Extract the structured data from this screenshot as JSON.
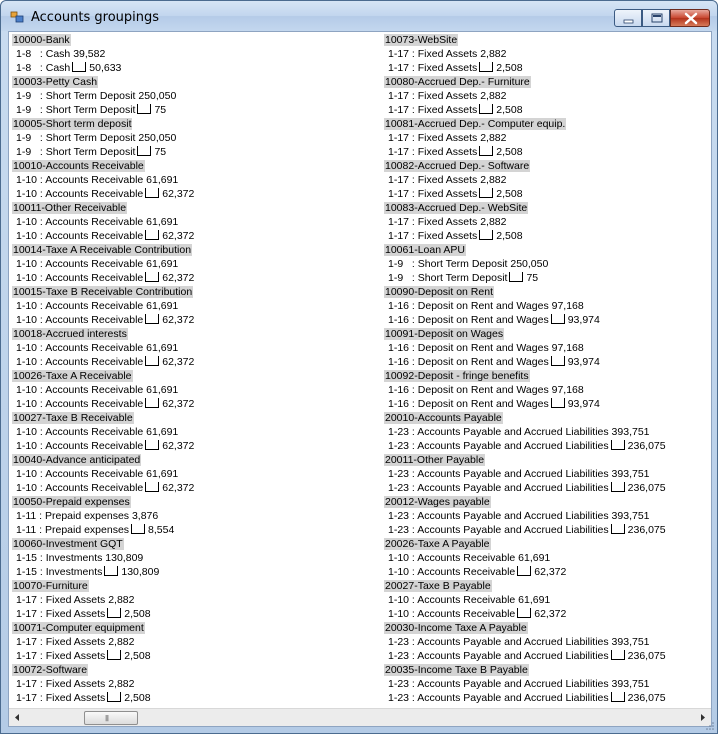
{
  "window": {
    "title": "Accounts groupings",
    "controls": {
      "minimize": "minimize-icon",
      "maximize": "maximize-icon",
      "close": "close-icon"
    }
  },
  "left_column": [
    {
      "kind": "head",
      "text": "10000-Bank"
    },
    {
      "kind": "item",
      "pre": "1-8   : Cash 39,582",
      "box": false,
      "post": ""
    },
    {
      "kind": "item",
      "pre": "1-8   : Cash",
      "box": true,
      "post": "50,633"
    },
    {
      "kind": "head",
      "text": "10003-Petty Cash"
    },
    {
      "kind": "item",
      "pre": "1-9   : Short Term Deposit 250,050",
      "box": false,
      "post": ""
    },
    {
      "kind": "item",
      "pre": "1-9   : Short Term Deposit",
      "box": true,
      "post": "75"
    },
    {
      "kind": "head",
      "text": "10005-Short term deposit"
    },
    {
      "kind": "item",
      "pre": "1-9   : Short Term Deposit 250,050",
      "box": false,
      "post": ""
    },
    {
      "kind": "item",
      "pre": "1-9   : Short Term Deposit",
      "box": true,
      "post": "75"
    },
    {
      "kind": "head",
      "text": "10010-Accounts Receivable"
    },
    {
      "kind": "item",
      "pre": "1-10 : Accounts Receivable 61,691",
      "box": false,
      "post": ""
    },
    {
      "kind": "item",
      "pre": "1-10 : Accounts Receivable",
      "box": true,
      "post": "62,372"
    },
    {
      "kind": "head",
      "text": "10011-Other Receivable"
    },
    {
      "kind": "item",
      "pre": "1-10 : Accounts Receivable 61,691",
      "box": false,
      "post": ""
    },
    {
      "kind": "item",
      "pre": "1-10 : Accounts Receivable",
      "box": true,
      "post": "62,372"
    },
    {
      "kind": "head",
      "text": "10014-Taxe A Receivable Contribution"
    },
    {
      "kind": "item",
      "pre": "1-10 : Accounts Receivable 61,691",
      "box": false,
      "post": ""
    },
    {
      "kind": "item",
      "pre": "1-10 : Accounts Receivable",
      "box": true,
      "post": "62,372"
    },
    {
      "kind": "head",
      "text": "10015-Taxe B Receivable Contribution"
    },
    {
      "kind": "item",
      "pre": "1-10 : Accounts Receivable 61,691",
      "box": false,
      "post": ""
    },
    {
      "kind": "item",
      "pre": "1-10 : Accounts Receivable",
      "box": true,
      "post": "62,372"
    },
    {
      "kind": "head",
      "text": "10018-Accrued interests"
    },
    {
      "kind": "item",
      "pre": "1-10 : Accounts Receivable 61,691",
      "box": false,
      "post": ""
    },
    {
      "kind": "item",
      "pre": "1-10 : Accounts Receivable",
      "box": true,
      "post": "62,372"
    },
    {
      "kind": "head",
      "text": "10026-Taxe A Receivable"
    },
    {
      "kind": "item",
      "pre": "1-10 : Accounts Receivable 61,691",
      "box": false,
      "post": ""
    },
    {
      "kind": "item",
      "pre": "1-10 : Accounts Receivable",
      "box": true,
      "post": "62,372"
    },
    {
      "kind": "head",
      "text": "10027-Taxe B Receivable"
    },
    {
      "kind": "item",
      "pre": "1-10 : Accounts Receivable 61,691",
      "box": false,
      "post": ""
    },
    {
      "kind": "item",
      "pre": "1-10 : Accounts Receivable",
      "box": true,
      "post": "62,372"
    },
    {
      "kind": "head",
      "text": "10040-Advance anticipated"
    },
    {
      "kind": "item",
      "pre": "1-10 : Accounts Receivable 61,691",
      "box": false,
      "post": ""
    },
    {
      "kind": "item",
      "pre": "1-10 : Accounts Receivable",
      "box": true,
      "post": "62,372"
    },
    {
      "kind": "head",
      "text": "10050-Prepaid expenses"
    },
    {
      "kind": "item",
      "pre": "1-11 : Prepaid expenses 3,876",
      "box": false,
      "post": ""
    },
    {
      "kind": "item",
      "pre": "1-11 : Prepaid expenses",
      "box": true,
      "post": "8,554"
    },
    {
      "kind": "head",
      "text": "10060-Investment GQT"
    },
    {
      "kind": "item",
      "pre": "1-15 : Investments 130,809",
      "box": false,
      "post": ""
    },
    {
      "kind": "item",
      "pre": "1-15 : Investments",
      "box": true,
      "post": "130,809"
    },
    {
      "kind": "head",
      "text": "10070-Furniture"
    },
    {
      "kind": "item",
      "pre": "1-17 : Fixed Assets 2,882",
      "box": false,
      "post": ""
    },
    {
      "kind": "item",
      "pre": "1-17 : Fixed Assets",
      "box": true,
      "post": "2,508"
    },
    {
      "kind": "head",
      "text": "10071-Computer equipment"
    },
    {
      "kind": "item",
      "pre": "1-17 : Fixed Assets 2,882",
      "box": false,
      "post": ""
    },
    {
      "kind": "item",
      "pre": "1-17 : Fixed Assets",
      "box": true,
      "post": "2,508"
    },
    {
      "kind": "head",
      "text": "10072-Software"
    },
    {
      "kind": "item",
      "pre": "1-17 : Fixed Assets 2,882",
      "box": false,
      "post": ""
    },
    {
      "kind": "item",
      "pre": "1-17 : Fixed Assets",
      "box": true,
      "post": "2,508"
    }
  ],
  "right_column": [
    {
      "kind": "head",
      "text": "10073-WebSite"
    },
    {
      "kind": "item",
      "pre": "1-17 : Fixed Assets 2,882",
      "box": false,
      "post": ""
    },
    {
      "kind": "item",
      "pre": "1-17 : Fixed Assets",
      "box": true,
      "post": "2,508"
    },
    {
      "kind": "head",
      "text": "10080-Accrued Dep.- Furniture"
    },
    {
      "kind": "item",
      "pre": "1-17 : Fixed Assets 2,882",
      "box": false,
      "post": ""
    },
    {
      "kind": "item",
      "pre": "1-17 : Fixed Assets",
      "box": true,
      "post": "2,508"
    },
    {
      "kind": "head",
      "text": "10081-Accrued Dep.- Computer equip."
    },
    {
      "kind": "item",
      "pre": "1-17 : Fixed Assets 2,882",
      "box": false,
      "post": ""
    },
    {
      "kind": "item",
      "pre": "1-17 : Fixed Assets",
      "box": true,
      "post": "2,508"
    },
    {
      "kind": "head",
      "text": "10082-Accrued Dep.- Software"
    },
    {
      "kind": "item",
      "pre": "1-17 : Fixed Assets 2,882",
      "box": false,
      "post": ""
    },
    {
      "kind": "item",
      "pre": "1-17 : Fixed Assets",
      "box": true,
      "post": "2,508"
    },
    {
      "kind": "head",
      "text": "10083-Accrued Dep.- WebSite"
    },
    {
      "kind": "item",
      "pre": "1-17 : Fixed Assets 2,882",
      "box": false,
      "post": ""
    },
    {
      "kind": "item",
      "pre": "1-17 : Fixed Assets",
      "box": true,
      "post": "2,508"
    },
    {
      "kind": "head",
      "text": "10061-Loan APU"
    },
    {
      "kind": "item",
      "pre": "1-9   : Short Term Deposit 250,050",
      "box": false,
      "post": ""
    },
    {
      "kind": "item",
      "pre": "1-9   : Short Term Deposit",
      "box": true,
      "post": "75"
    },
    {
      "kind": "head",
      "text": "10090-Deposit on Rent"
    },
    {
      "kind": "item",
      "pre": "1-16 : Deposit on Rent and Wages 97,168",
      "box": false,
      "post": ""
    },
    {
      "kind": "item",
      "pre": "1-16 : Deposit on Rent and Wages",
      "box": true,
      "post": "93,974"
    },
    {
      "kind": "head",
      "text": "10091-Deposit on Wages"
    },
    {
      "kind": "item",
      "pre": "1-16 : Deposit on Rent and Wages 97,168",
      "box": false,
      "post": ""
    },
    {
      "kind": "item",
      "pre": "1-16 : Deposit on Rent and Wages",
      "box": true,
      "post": "93,974"
    },
    {
      "kind": "head",
      "text": "10092-Deposit - fringe benefits"
    },
    {
      "kind": "item",
      "pre": "1-16 : Deposit on Rent and Wages 97,168",
      "box": false,
      "post": ""
    },
    {
      "kind": "item",
      "pre": "1-16 : Deposit on Rent and Wages",
      "box": true,
      "post": "93,974"
    },
    {
      "kind": "head",
      "text": "20010-Accounts Payable"
    },
    {
      "kind": "item",
      "pre": "1-23 : Accounts Payable and Accrued Liabilities 393,751",
      "box": false,
      "post": ""
    },
    {
      "kind": "item",
      "pre": "1-23 : Accounts Payable and Accrued Liabilities",
      "box": true,
      "post": "236,075"
    },
    {
      "kind": "head",
      "text": "20011-Other Payable"
    },
    {
      "kind": "item",
      "pre": "1-23 : Accounts Payable and Accrued Liabilities 393,751",
      "box": false,
      "post": ""
    },
    {
      "kind": "item",
      "pre": "1-23 : Accounts Payable and Accrued Liabilities",
      "box": true,
      "post": "236,075"
    },
    {
      "kind": "head",
      "text": "20012-Wages payable"
    },
    {
      "kind": "item",
      "pre": "1-23 : Accounts Payable and Accrued Liabilities 393,751",
      "box": false,
      "post": ""
    },
    {
      "kind": "item",
      "pre": "1-23 : Accounts Payable and Accrued Liabilities",
      "box": true,
      "post": "236,075"
    },
    {
      "kind": "head",
      "text": "20026-Taxe A Payable"
    },
    {
      "kind": "item",
      "pre": "1-10 : Accounts Receivable 61,691",
      "box": false,
      "post": ""
    },
    {
      "kind": "item",
      "pre": "1-10 : Accounts Receivable",
      "box": true,
      "post": "62,372"
    },
    {
      "kind": "head",
      "text": "20027-Taxe B Payable"
    },
    {
      "kind": "item",
      "pre": "1-10 : Accounts Receivable 61,691",
      "box": false,
      "post": ""
    },
    {
      "kind": "item",
      "pre": "1-10 : Accounts Receivable",
      "box": true,
      "post": "62,372"
    },
    {
      "kind": "head",
      "text": "20030-Income Taxe A Payable"
    },
    {
      "kind": "item",
      "pre": "1-23 : Accounts Payable and Accrued Liabilities 393,751",
      "box": false,
      "post": ""
    },
    {
      "kind": "item",
      "pre": "1-23 : Accounts Payable and Accrued Liabilities",
      "box": true,
      "post": "236,075"
    },
    {
      "kind": "head",
      "text": "20035-Income Taxe B Payable"
    },
    {
      "kind": "item",
      "pre": "1-23 : Accounts Payable and Accrued Liabilities 393,751",
      "box": false,
      "post": ""
    },
    {
      "kind": "item",
      "pre": "1-23 : Accounts Payable and Accrued Liabilities",
      "box": true,
      "post": "236,075"
    }
  ],
  "scrollbar": {
    "left_arrow": "scroll-left-icon",
    "right_arrow": "scroll-right-icon",
    "thumb_grip": "|||"
  }
}
